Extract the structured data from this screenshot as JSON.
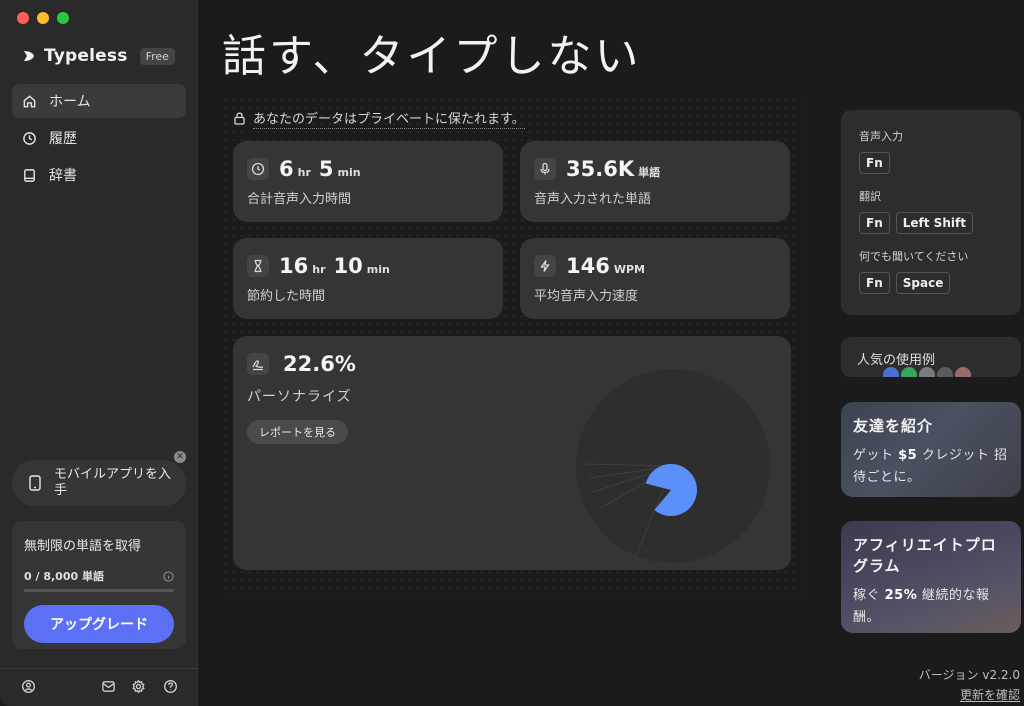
{
  "app": {
    "name": "Typeless",
    "plan_badge": "Free"
  },
  "sidebar": {
    "items": [
      {
        "label": "ホーム",
        "icon": "home-icon",
        "active": true
      },
      {
        "label": "履歴",
        "icon": "history-icon",
        "active": false
      },
      {
        "label": "辞書",
        "icon": "book-icon",
        "active": false
      }
    ],
    "mobile_card": {
      "label": "モバイルアプリを入手",
      "icon": "phone-icon"
    },
    "upgrade": {
      "title": "無制限の単語を取得",
      "usage": "0 / 8,000 単語",
      "usage_fraction": 0.0,
      "button": "アップグレード"
    },
    "footer_icons": [
      "account-icon",
      "mail-icon",
      "settings-icon",
      "help-icon"
    ]
  },
  "main": {
    "title": "話す、タイプしない",
    "privacy_note": "あなたのデータはプライベートに保たれます。",
    "stats": {
      "dictation_time": {
        "hours": "6",
        "hr_unit": "hr",
        "minutes": "5",
        "min_unit": "min",
        "label": "合計音声入力時間"
      },
      "words": {
        "value": "35.6K",
        "unit": "単語",
        "label": "音声入力された単語"
      },
      "time_saved": {
        "hours": "16",
        "hr_unit": "hr",
        "minutes": "10",
        "min_unit": "min",
        "label": "節約した時間"
      },
      "speed": {
        "value": "146",
        "unit": "WPM",
        "label": "平均音声入力速度"
      }
    },
    "personalize": {
      "percent": "22.6%",
      "value": 22.6,
      "label": "パーソナライズ",
      "button": "レポートを見る",
      "accent_color": "#5b8ff9"
    }
  },
  "right": {
    "shortcuts": [
      {
        "label": "音声入力",
        "keys": [
          "Fn"
        ]
      },
      {
        "label": "翻訳",
        "keys": [
          "Fn",
          "Left Shift"
        ]
      },
      {
        "label": "何でも聞いてください",
        "keys": [
          "Fn",
          "Space"
        ]
      }
    ],
    "popular": {
      "title": "人気の使用例"
    },
    "refer": {
      "title": "友達を紹介",
      "desc_prefix": "ゲット ",
      "desc_bold": "$5",
      "desc_suffix": " クレジット 招待ごとに。"
    },
    "affiliate": {
      "title": "アフィリエイトプログラム",
      "desc_prefix": "稼ぐ ",
      "desc_bold": "25%",
      "desc_suffix": " 継続的な報酬。"
    },
    "version": "バージョン v2.2.0",
    "update_link": "更新を確認"
  },
  "colors": {
    "accent": "#5b70f5",
    "chart_accent": "#5b8ff9"
  }
}
